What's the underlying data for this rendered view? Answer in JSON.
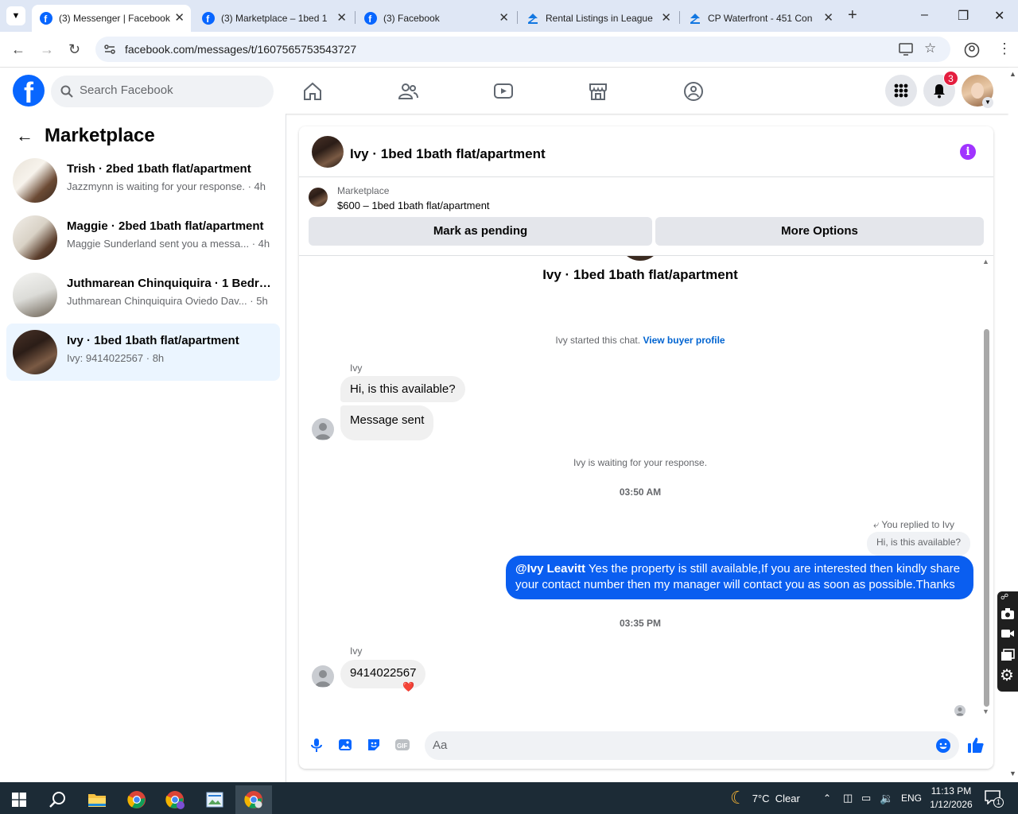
{
  "browser": {
    "tabs": [
      {
        "title": "(3) Messenger | Facebook",
        "active": true
      },
      {
        "title": "(3) Marketplace – 1bed 1",
        "active": false
      },
      {
        "title": "(3) Facebook",
        "active": false
      },
      {
        "title": "Rental Listings in League",
        "active": false
      },
      {
        "title": "CP Waterfront - 451 Con",
        "active": false
      }
    ],
    "url": "facebook.com/messages/t/1607565753543727"
  },
  "fb_header": {
    "search_placeholder": "Search Facebook",
    "notification_count": "3"
  },
  "left_panel": {
    "title": "Marketplace",
    "conversations": [
      {
        "name": "Trish · 2bed 1bath flat/apartment",
        "preview": "Jazzmynn is waiting for your response. · 4h",
        "selected": false
      },
      {
        "name": "Maggie · 2bed 1bath flat/apartment",
        "preview": "Maggie Sunderland sent you a messa... · 4h",
        "selected": false
      },
      {
        "name": "Juthmarean Chinquiquira · 1 Bedro...",
        "preview": "Juthmarean Chinquiquira Oviedo Dav... · 5h",
        "selected": false
      },
      {
        "name": "Ivy · 1bed 1bath flat/apartment",
        "preview": "Ivy: 9414022567 · 8h",
        "selected": true
      }
    ]
  },
  "chat": {
    "title": "Ivy · 1bed 1bath flat/apartment",
    "listing_label": "Marketplace",
    "listing_price": "$600 – 1bed 1bath flat/apartment",
    "mark_pending": "Mark as pending",
    "more_options": "More Options",
    "intro_title": "Ivy · 1bed 1bath flat/apartment",
    "started_text": "Ivy started this chat.",
    "view_profile": "View buyer profile",
    "sender_name_1": "Ivy",
    "msg_1": "Hi, is this available?",
    "msg_2": "Message sent",
    "waiting_text": "Ivy is waiting for your response.",
    "time_1": "03:50 AM",
    "replied_to": "You replied to Ivy",
    "quoted": "Hi, is this available?",
    "mention": "@Ivy Leavitt",
    "reply_line1": " Yes the property is still available,If you are interested then kindly share",
    "reply_line2": "your contact number then my manager will contact you as soon as possible.Thanks",
    "time_2": "03:35 PM",
    "sender_name_2": "Ivy",
    "msg_3": "9414022567",
    "reaction": "❤️",
    "composer_placeholder": "Aa"
  },
  "taskbar": {
    "weather": "7°C  Clear",
    "lang": "ENG",
    "time": "11:13 PM",
    "date": "1/12/2026",
    "notif": "1"
  },
  "colors": {
    "fb_blue": "#0866ff",
    "sent_bubble": "#0a5ef0",
    "selected_row": "#ebf5ff",
    "info_purple": "#a033ff",
    "tab_strip": "#dfe7f5",
    "taskbar": "#1c2b36"
  }
}
